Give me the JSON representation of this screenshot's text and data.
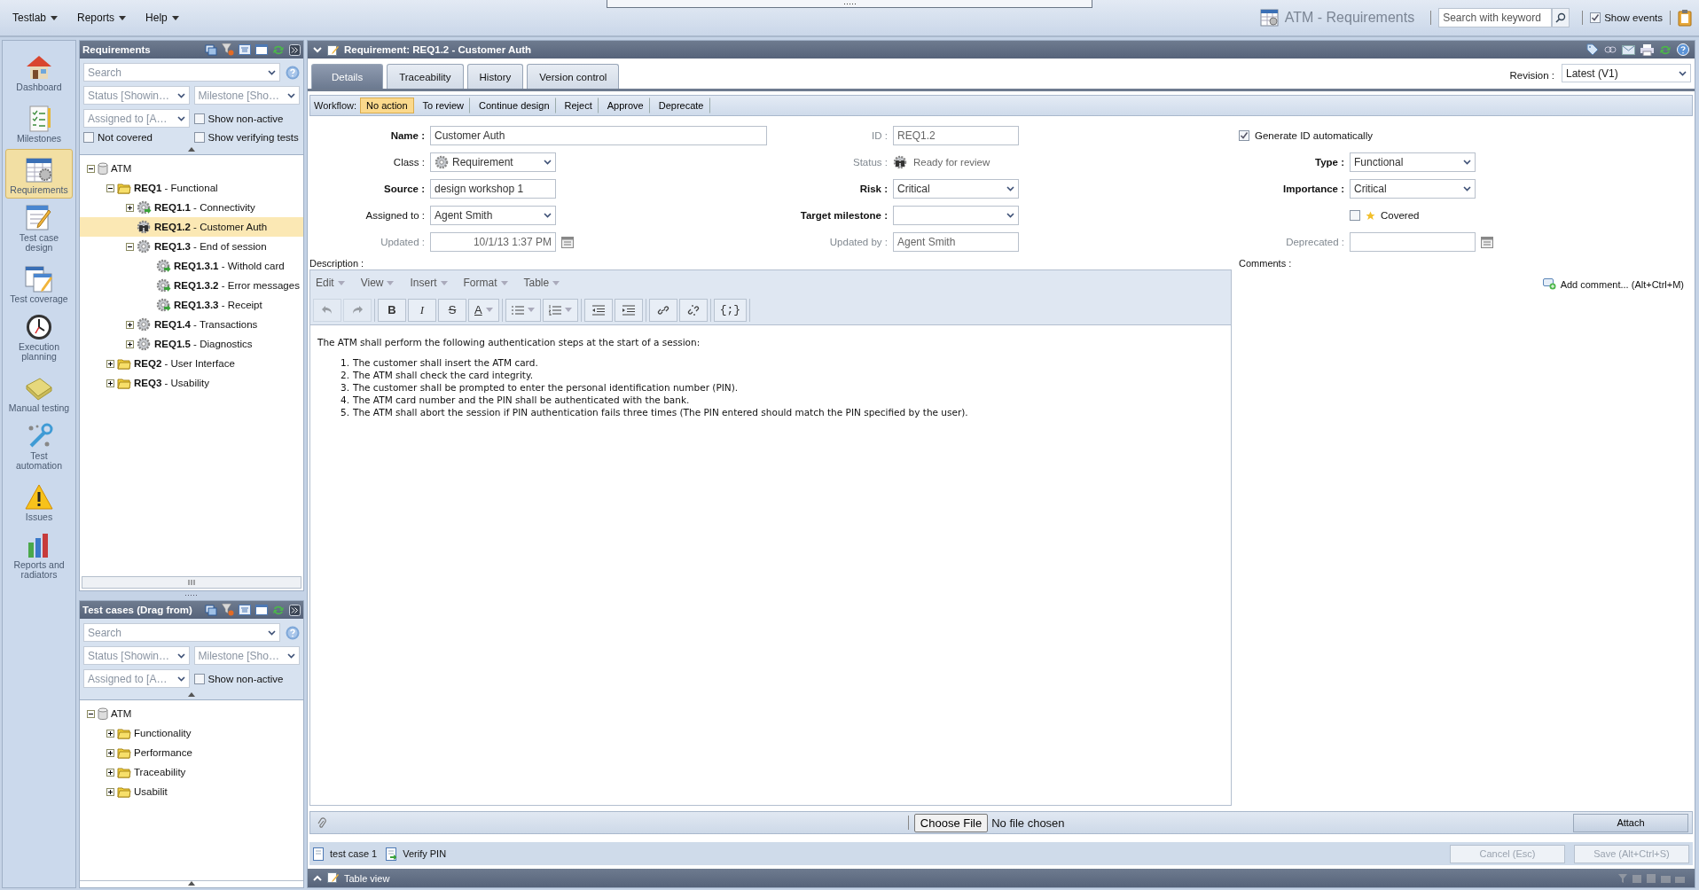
{
  "menu": [
    {
      "label": "Testlab"
    },
    {
      "label": "Reports"
    },
    {
      "label": "Help"
    }
  ],
  "header": {
    "title": "ATM - Requirements",
    "search": {
      "placeholder": "Search with keyword"
    },
    "show_events": {
      "label": "Show events",
      "checked": true
    }
  },
  "nav": [
    {
      "label": "Dashboard",
      "selected": false
    },
    {
      "label": "Milestones",
      "selected": false
    },
    {
      "label": "Requirements",
      "selected": true
    },
    {
      "label": "Test case design",
      "selected": false
    },
    {
      "label": "Test coverage",
      "selected": false
    },
    {
      "label": "Execution planning",
      "selected": false
    },
    {
      "label": "Manual testing",
      "selected": false
    },
    {
      "label": "Test automation",
      "selected": false
    },
    {
      "label": "Issues",
      "selected": false
    },
    {
      "label": "Reports and radiators",
      "selected": false
    }
  ],
  "requirements_panel": {
    "title": "Requirements",
    "search": {
      "placeholder": "Search"
    },
    "filters": [
      {
        "kind": "select",
        "placeholder": "Status [Showin…"
      },
      {
        "kind": "select",
        "placeholder": "Milestone [Sho…"
      },
      {
        "kind": "select",
        "placeholder": "Assigned to [A…"
      },
      {
        "kind": "checkbox",
        "label": "Show non-active",
        "checked": false
      },
      {
        "kind": "checkbox",
        "label": "Not covered",
        "checked": false
      },
      {
        "kind": "checkbox",
        "label": "Show verifying tests",
        "checked": false
      }
    ],
    "tree": [
      {
        "label": "ATM",
        "kind": "database",
        "expanded": true,
        "selected": false,
        "children": [
          {
            "label": "**REQ1** - Functional",
            "kind": "folder",
            "expanded": true,
            "selected": false,
            "children": [
              {
                "label": "**REQ1.1** - Connectivity",
                "kind": "gear-arrow",
                "expanded": false,
                "selected": false
              },
              {
                "label": "**REQ1.2** - Customer Auth",
                "kind": "review",
                "selected": true
              },
              {
                "label": "**REQ1.3** - End of session",
                "kind": "gear",
                "expanded": true,
                "selected": false,
                "children": [
                  {
                    "label": "**REQ1.3.1** - Withold card",
                    "kind": "gear-arrow",
                    "selected": false
                  },
                  {
                    "label": "**REQ1.3.2** - Error messages",
                    "kind": "gear-arrow",
                    "selected": false
                  },
                  {
                    "label": "**REQ1.3.3** - Receipt",
                    "kind": "gear-arrow",
                    "selected": false
                  }
                ]
              },
              {
                "label": "**REQ1.4** - Transactions",
                "kind": "gear",
                "expanded": false,
                "selected": false
              },
              {
                "label": "**REQ1.5** - Diagnostics",
                "kind": "gear",
                "expanded": false,
                "selected": false
              }
            ]
          },
          {
            "label": "**REQ2** - User Interface",
            "kind": "folder",
            "expanded": false,
            "selected": false
          },
          {
            "label": "**REQ3** - Usability",
            "kind": "folder",
            "expanded": false,
            "selected": false
          }
        ]
      }
    ]
  },
  "test_cases_panel": {
    "title": "Test cases (Drag from)",
    "search": {
      "placeholder": "Search"
    },
    "filters": [
      {
        "kind": "select",
        "placeholder": "Status [Showin…"
      },
      {
        "kind": "select",
        "placeholder": "Milestone [Sho…"
      },
      {
        "kind": "select",
        "placeholder": "Assigned to [A…"
      },
      {
        "kind": "checkbox",
        "label": "Show non-active",
        "checked": false
      }
    ],
    "tree": [
      {
        "label": "ATM",
        "kind": "database",
        "expanded": true,
        "selected": false,
        "children": [
          {
            "label": "Functionality",
            "kind": "folder",
            "expanded": false,
            "selected": false
          },
          {
            "label": "Performance",
            "kind": "folder",
            "expanded": false,
            "selected": false
          },
          {
            "label": "Traceability",
            "kind": "folder",
            "expanded": false,
            "selected": false
          },
          {
            "label": "Usabilit",
            "kind": "folder",
            "expanded": false,
            "selected": false
          }
        ]
      }
    ]
  },
  "editor": {
    "title": "Requirement: REQ1.2 - Customer Auth",
    "tabs": [
      {
        "label": "Details",
        "selected": true
      },
      {
        "label": "Traceability",
        "selected": false
      },
      {
        "label": "History",
        "selected": false
      },
      {
        "label": "Version control",
        "selected": false
      }
    ],
    "revision": {
      "label": "Revision :",
      "value": "Latest (V1)"
    },
    "workflow": {
      "label": "Workflow:",
      "actions": [
        {
          "label": "No action",
          "selected": true
        },
        {
          "label": "To review",
          "selected": false
        },
        {
          "label": "Continue design",
          "selected": false
        },
        {
          "label": "Reject",
          "selected": false
        },
        {
          "label": "Approve",
          "selected": false
        },
        {
          "label": "Deprecate",
          "selected": false
        }
      ]
    },
    "fields": [
      [
        {
          "label": "Name :",
          "kind": "text",
          "value": "Customer Auth",
          "required": true,
          "readonly": false,
          "wide": true
        },
        {
          "label": "ID :",
          "kind": "text",
          "value": "REQ1.2",
          "required": false,
          "readonly": true
        },
        {
          "kind": "option",
          "label": "Generate ID automatically",
          "checked": true
        }
      ],
      [
        {
          "label": "Class :",
          "kind": "icon-select",
          "value": "Requirement",
          "required": false,
          "readonly": false
        },
        {
          "label": "Status :",
          "kind": "status",
          "value": "Ready for review",
          "required": false,
          "readonly": true
        },
        {
          "label": "Type :",
          "kind": "select",
          "value": "Functional",
          "required": true,
          "readonly": false
        }
      ],
      [
        {
          "label": "Source :",
          "kind": "text",
          "value": "design workshop 1",
          "required": true,
          "readonly": false
        },
        {
          "label": "Risk :",
          "kind": "select",
          "value": "Critical",
          "required": true,
          "readonly": false
        },
        {
          "label": "Importance :",
          "kind": "select",
          "value": "Critical",
          "required": true,
          "readonly": false
        }
      ],
      [
        {
          "label": "Assigned to :",
          "kind": "select",
          "value": "Agent Smith",
          "required": false,
          "readonly": false
        },
        {
          "label": "Target milestone :",
          "kind": "select",
          "required": true,
          "readonly": false
        },
        {
          "kind": "star-checkbox",
          "label": "Covered",
          "checked": false
        }
      ],
      [
        {
          "label": "Updated :",
          "kind": "date",
          "value": "10/1/13 1:37 PM",
          "required": false,
          "readonly": true
        },
        {
          "label": "Updated by :",
          "kind": "text",
          "value": "Agent Smith",
          "required": false,
          "readonly": true
        },
        {
          "label": "Deprecated :",
          "kind": "date",
          "required": false,
          "readonly": true
        }
      ]
    ],
    "description": {
      "label": "Description :",
      "menus": [
        {
          "label": "Edit"
        },
        {
          "label": "View"
        },
        {
          "label": "Insert"
        },
        {
          "label": "Format"
        },
        {
          "label": "Table"
        }
      ],
      "toolbar": [
        [
          {
            "kind": "undo",
            "disabled": true
          },
          {
            "kind": "redo",
            "disabled": true
          }
        ],
        [
          {
            "kind": "bold",
            "label": "B",
            "disabled": false
          },
          {
            "kind": "italic",
            "label": "I",
            "disabled": false
          },
          {
            "kind": "strike",
            "label": "S",
            "disabled": false
          },
          {
            "kind": "color",
            "label": "A",
            "disabled": false
          }
        ],
        [
          {
            "kind": "bullets",
            "disabled": false
          },
          {
            "kind": "numbers",
            "disabled": false
          }
        ],
        [
          {
            "kind": "outdent",
            "disabled": false
          },
          {
            "kind": "indent",
            "disabled": false
          }
        ],
        [
          {
            "kind": "link",
            "disabled": false
          },
          {
            "kind": "unlink",
            "disabled": false
          }
        ],
        [
          {
            "kind": "code",
            "label": "{;}",
            "disabled": false
          }
        ]
      ],
      "intro": "The ATM shall perform the following authentication steps at the start of a session:",
      "steps": [
        {
          "number": "1.",
          "text": "The customer shall insert the ATM card."
        },
        {
          "number": "2.",
          "text": "The ATM shall check the card integrity."
        },
        {
          "number": "3.",
          "text": "The customer shall be prompted to enter the personal identification number (PIN)."
        },
        {
          "number": "4.",
          "text": "The ATM card number and the PIN shall be authenticated with the bank."
        },
        {
          "number": "5.",
          "text": "The ATM shall abort the session if PIN authentication fails three times (The PIN entered should match the PIN specified by the user)."
        }
      ]
    },
    "comments": {
      "label": "Comments :",
      "add": "Add comment... (Alt+Ctrl+M)"
    },
    "attachment": {
      "choose": "Choose File",
      "status": "No file chosen",
      "button": "Attach"
    },
    "links": [
      {
        "label": "test case 1"
      },
      {
        "label": "Verify PIN"
      }
    ],
    "buttons": [
      {
        "label": "Cancel (Esc)",
        "disabled": true
      },
      {
        "label": "Save (Alt+Ctrl+S)",
        "disabled": true
      }
    ]
  },
  "table_view": {
    "label": "Table view"
  }
}
